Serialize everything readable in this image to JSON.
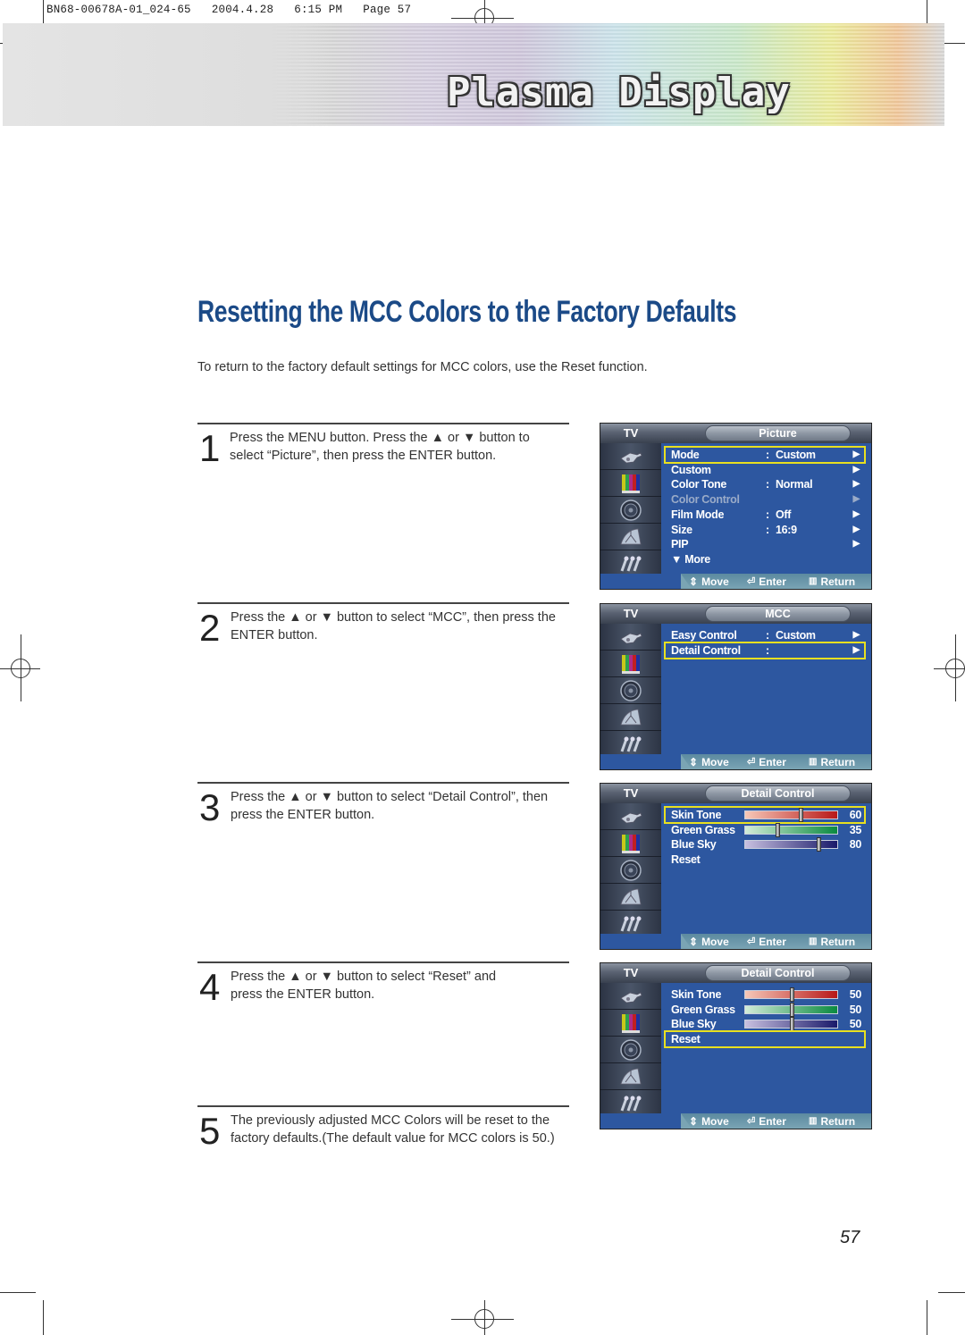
{
  "print_header": "BN68-00678A-01_024-65   2004.4.28   6:15 PM   Page 57",
  "banner": {
    "title": "Plasma Display"
  },
  "page_title": "Resetting the MCC Colors to the Factory Defaults",
  "intro": "To return to the factory default settings for MCC colors, use the Reset function.",
  "steps": [
    {
      "number": "1",
      "text": "Press the MENU button. Press the ▲ or ▼ button to select “Picture”, then press the ENTER button."
    },
    {
      "number": "2",
      "text": "Press the ▲ or ▼ button to select “MCC”, then press the ENTER button."
    },
    {
      "number": "3",
      "text": "Press the ▲ or ▼ button to select “Detail Control”, then press the ENTER button."
    },
    {
      "number": "4",
      "text": "Press the ▲ or ▼ button to select “Reset” and press the ENTER button."
    },
    {
      "number": "5",
      "text": "The previously adjusted MCC Colors will be reset to the factory defaults.(The default value for MCC colors is 50.)"
    }
  ],
  "osd_common": {
    "tv_label": "TV",
    "sidebar_icons": [
      "input-plug-icon",
      "picture-color-bars-icon",
      "sound-speaker-icon",
      "channel-satellite-icon",
      "setup-connectors-icon"
    ],
    "footer": {
      "move": "Move",
      "enter": "Enter",
      "return": "Return"
    },
    "arrow": "▶"
  },
  "screens": [
    {
      "tab": "Picture",
      "rows": [
        {
          "label": "Mode",
          "colon": ":",
          "value": "Custom",
          "arrow": true,
          "highlight": true
        },
        {
          "label": "Custom",
          "arrow": true
        },
        {
          "label": "Color Tone",
          "colon": ":",
          "value": "Normal",
          "arrow": true
        },
        {
          "label": "Color Control",
          "arrow": true,
          "dim": true
        },
        {
          "label": "Film Mode",
          "colon": ":",
          "value": "Off",
          "arrow": true
        },
        {
          "label": "Size",
          "colon": ":",
          "value": "16:9",
          "arrow": true
        },
        {
          "label": "PIP",
          "arrow": true
        },
        {
          "label": "▼ More"
        }
      ]
    },
    {
      "tab": "MCC",
      "rows": [
        {
          "label": "Easy Control",
          "colon": ":",
          "value": "Custom",
          "arrow": true
        },
        {
          "label": "Detail Control",
          "colon": ":",
          "value": "",
          "arrow": true,
          "highlight": true
        }
      ]
    },
    {
      "tab": "Detail Control",
      "rows": [
        {
          "label": "Skin Tone",
          "slider": "red",
          "value_num": 60,
          "highlight": true
        },
        {
          "label": "Green Grass",
          "slider": "green",
          "value_num": 35
        },
        {
          "label": "Blue Sky",
          "slider": "blue",
          "value_num": 80
        },
        {
          "label": "Reset"
        }
      ]
    },
    {
      "tab": "Detail Control",
      "rows": [
        {
          "label": "Skin Tone",
          "slider": "red",
          "value_num": 50
        },
        {
          "label": "Green Grass",
          "slider": "green",
          "value_num": 50
        },
        {
          "label": "Blue Sky",
          "slider": "blue",
          "value_num": 50
        },
        {
          "label": "Reset",
          "highlight": true
        }
      ]
    }
  ],
  "slider_colors": {
    "red": [
      "#f6c8b8",
      "#b81818"
    ],
    "green": [
      "#d2ecd8",
      "#0a8a40"
    ],
    "blue": [
      "#c8c0e0",
      "#1a1a6a"
    ]
  },
  "page_number": "57"
}
